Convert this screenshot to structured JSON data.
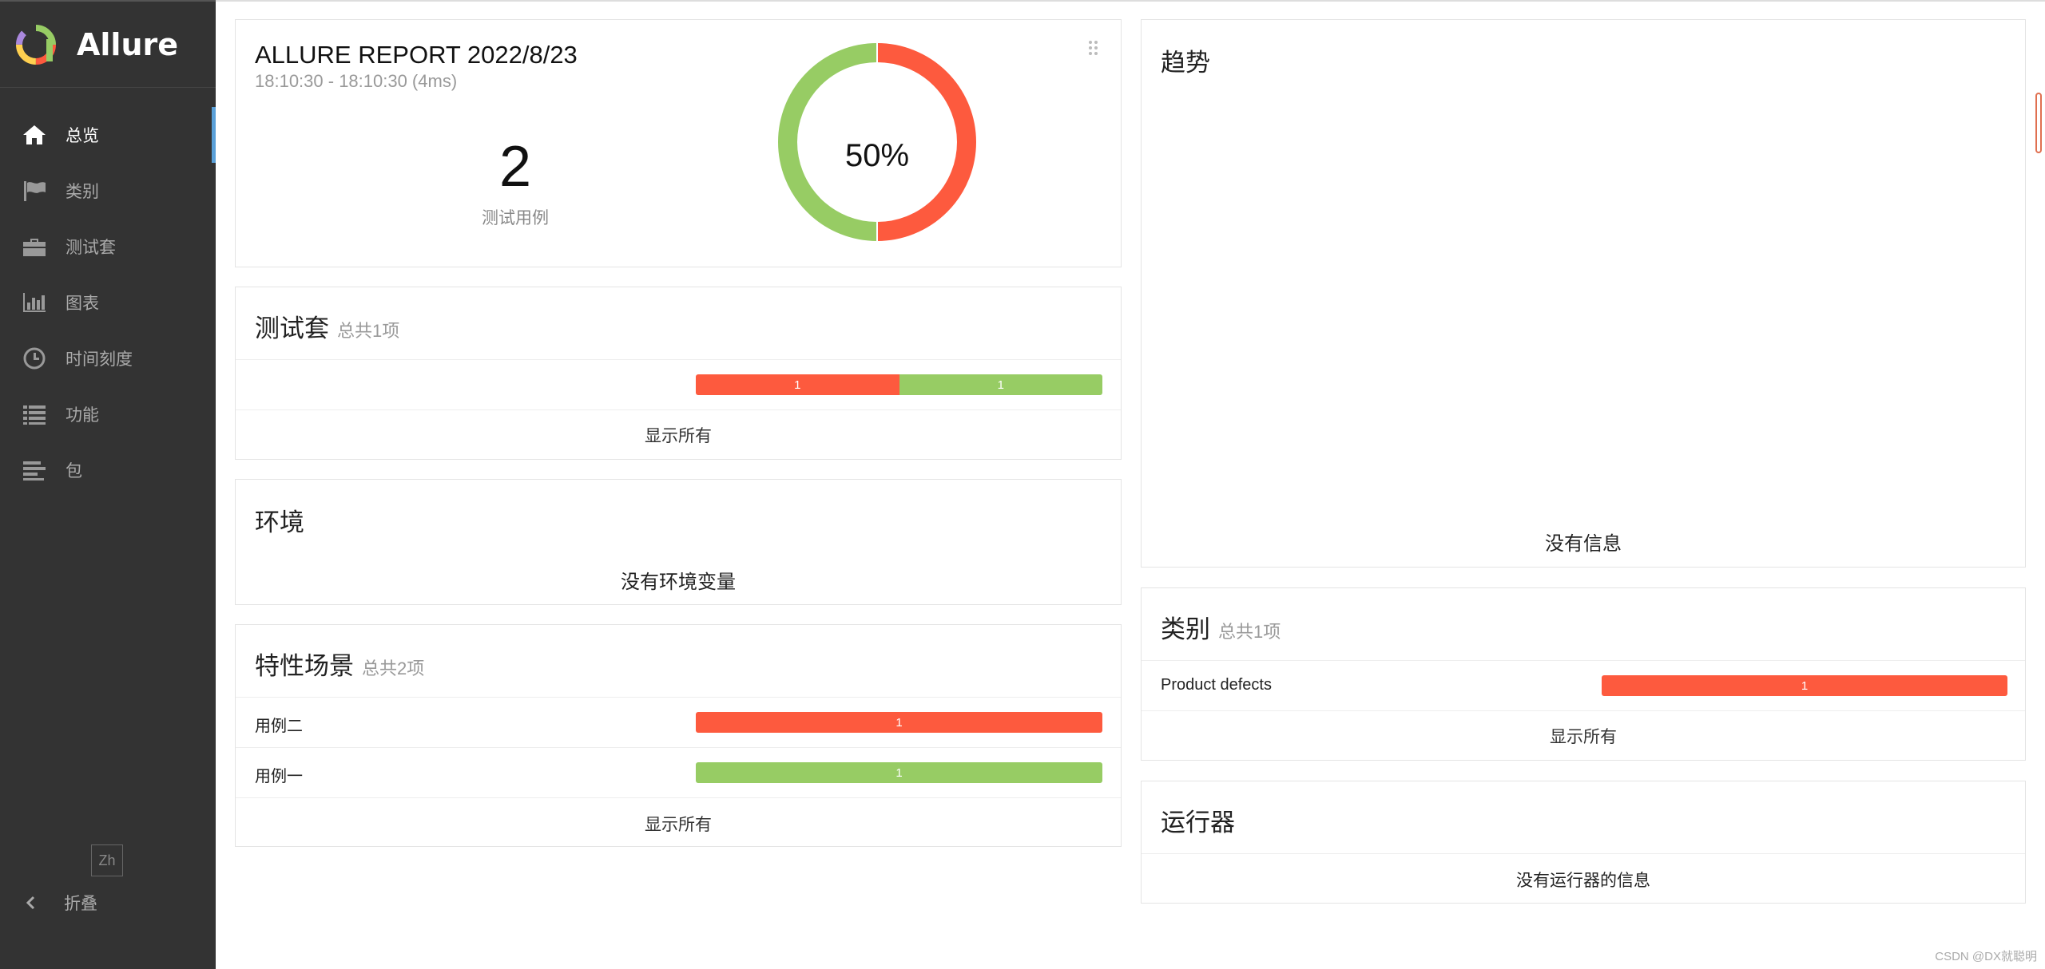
{
  "app": {
    "name": "Allure"
  },
  "nav": {
    "items": [
      {
        "label": "总览",
        "icon": "home-icon",
        "active": true
      },
      {
        "label": "类别",
        "icon": "flag-icon"
      },
      {
        "label": "测试套",
        "icon": "briefcase-icon"
      },
      {
        "label": "图表",
        "icon": "bar-chart-icon"
      },
      {
        "label": "时间刻度",
        "icon": "clock-icon"
      },
      {
        "label": "功能",
        "icon": "list-icon"
      },
      {
        "label": "包",
        "icon": "align-left-icon"
      }
    ],
    "lang": "Zh",
    "collapse": "折叠"
  },
  "summary": {
    "title": "ALLURE REPORT 2022/8/23",
    "time": "18:10:30 - 18:10:30 (4ms)",
    "count": "2",
    "count_label": "测试用例",
    "percent": "50%",
    "failed_fraction": 0.5,
    "passed_fraction": 0.5
  },
  "suites": {
    "title": "测试套",
    "subtitle": "总共1项",
    "bar": {
      "failed": "1",
      "passed": "1"
    },
    "show_all": "显示所有"
  },
  "environment": {
    "title": "环境",
    "empty": "没有环境变量"
  },
  "features": {
    "title": "特性场景",
    "subtitle": "总共2项",
    "rows": [
      {
        "label": "用例二",
        "value": "1",
        "status": "failed"
      },
      {
        "label": "用例一",
        "value": "1",
        "status": "passed"
      }
    ],
    "show_all": "显示所有"
  },
  "trend": {
    "title": "趋势",
    "empty": "没有信息"
  },
  "categories": {
    "title": "类别",
    "subtitle": "总共1项",
    "rows": [
      {
        "label": "Product defects",
        "value": "1"
      }
    ],
    "show_all": "显示所有"
  },
  "executors": {
    "title": "运行器",
    "empty": "没有运行器的信息"
  },
  "watermark": "CSDN @DX就聪明",
  "colors": {
    "failed": "#fd5a3e",
    "passed": "#97cc64",
    "sidebar": "#333333",
    "accent": "#5aa0d8"
  }
}
